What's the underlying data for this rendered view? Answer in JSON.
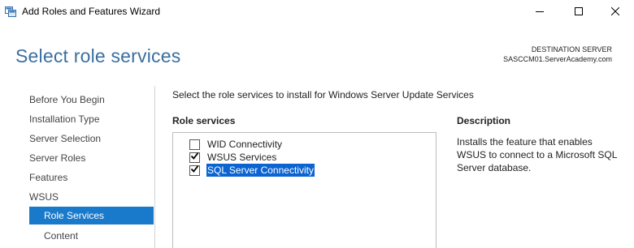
{
  "window": {
    "title": "Add Roles and Features Wizard",
    "icon": "server-manager-icon"
  },
  "header": {
    "page_title": "Select role services",
    "destination_label": "DESTINATION SERVER",
    "destination_value": "SASCCM01.ServerAcademy.com"
  },
  "nav": {
    "items": [
      {
        "label": "Before You Begin"
      },
      {
        "label": "Installation Type"
      },
      {
        "label": "Server Selection"
      },
      {
        "label": "Server Roles"
      },
      {
        "label": "Features"
      },
      {
        "label": "WSUS"
      },
      {
        "label": "Role Services",
        "selected": true
      },
      {
        "label": "Content"
      }
    ]
  },
  "main": {
    "instruction": "Select the role services to install for Windows Server Update Services",
    "role_services_header": "Role services",
    "description_header": "Description",
    "roles": [
      {
        "label": "WID Connectivity",
        "checked": false
      },
      {
        "label": "WSUS Services",
        "checked": true
      },
      {
        "label": "SQL Server Connectivity",
        "checked": true,
        "highlighted": true
      }
    ],
    "description": "Installs the feature that enables WSUS to connect to a Microsoft SQL Server database."
  },
  "colors": {
    "accent": "#1979ca",
    "title_blue": "#3b6fa0",
    "highlight": "#0a64d2"
  }
}
